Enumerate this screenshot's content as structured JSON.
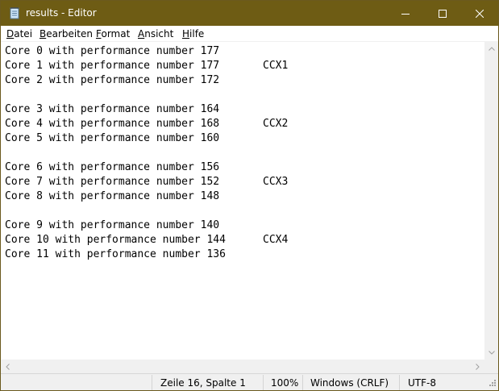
{
  "window": {
    "title": "results - Editor",
    "titlebar_color": "#6e5c14"
  },
  "menu": {
    "items": [
      {
        "u": "D",
        "rest": "atei"
      },
      {
        "u": "B",
        "rest": "earbeiten"
      },
      {
        "u": "F",
        "rest": "ormat"
      },
      {
        "u": "A",
        "rest": "nsicht"
      },
      {
        "u": "H",
        "rest": "ilfe"
      }
    ]
  },
  "document": {
    "lines": [
      {
        "text": "Core 0 with performance number 177",
        "tag": ""
      },
      {
        "text": "Core 1 with performance number 177",
        "tag": "CCX1"
      },
      {
        "text": "Core 2 with performance number 172",
        "tag": ""
      },
      {
        "text": "",
        "tag": ""
      },
      {
        "text": "Core 3 with performance number 164",
        "tag": ""
      },
      {
        "text": "Core 4 with performance number 168",
        "tag": "CCX2"
      },
      {
        "text": "Core 5 with performance number 160",
        "tag": ""
      },
      {
        "text": "",
        "tag": ""
      },
      {
        "text": "Core 6 with performance number 156",
        "tag": ""
      },
      {
        "text": "Core 7 with performance number 152",
        "tag": "CCX3"
      },
      {
        "text": "Core 8 with performance number 148",
        "tag": ""
      },
      {
        "text": "",
        "tag": ""
      },
      {
        "text": "Core 9 with performance number 140",
        "tag": ""
      },
      {
        "text": "Core 10 with performance number 144",
        "tag": "CCX4"
      },
      {
        "text": "Core 11 with performance number 136",
        "tag": ""
      }
    ]
  },
  "status": {
    "position": "Zeile 16, Spalte 1",
    "zoom": "100%",
    "line_ending": "Windows (CRLF)",
    "encoding": "UTF-8"
  }
}
